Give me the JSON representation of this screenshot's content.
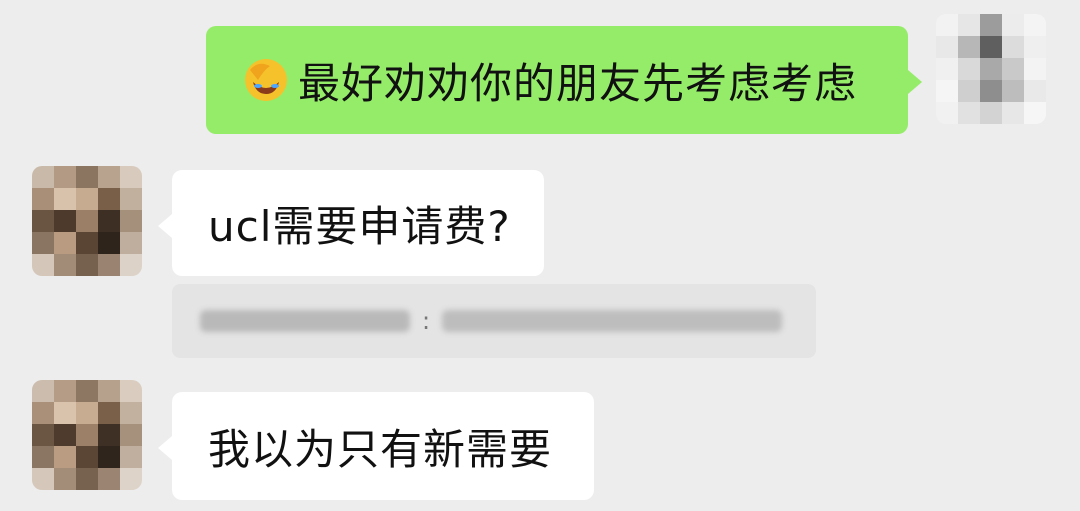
{
  "messages": [
    {
      "direction": "outgoing",
      "emoji": "face-palm-emoji",
      "text": "最好劝劝你的朋友先考虑考虑"
    },
    {
      "direction": "incoming",
      "text": "ucl需要申请费?"
    },
    {
      "direction": "incoming",
      "text": "我以为只有新需要"
    }
  ],
  "quote": {
    "separator": ":"
  },
  "colors": {
    "background": "#ededed",
    "outgoing_bubble": "#95ec69",
    "incoming_bubble": "#ffffff"
  }
}
